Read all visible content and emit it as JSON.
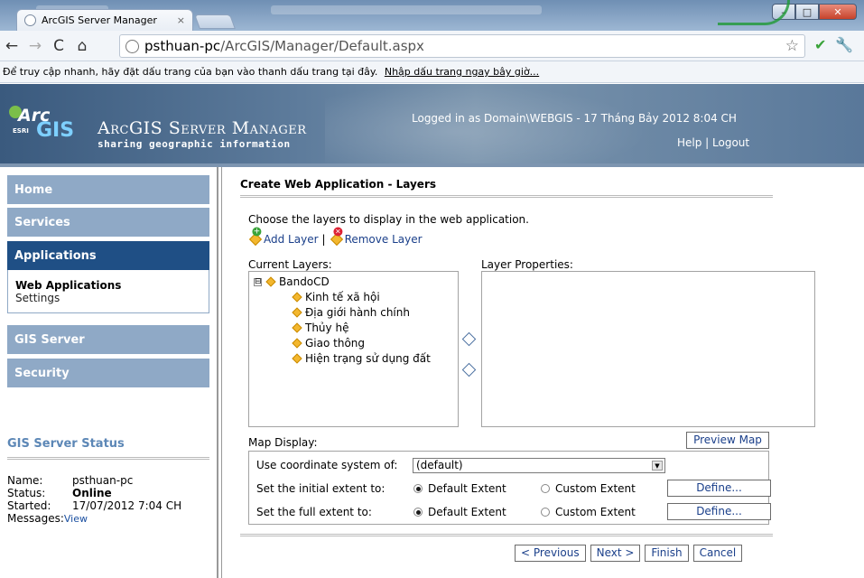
{
  "browser": {
    "tab_title": "ArcGIS Server Manager",
    "tab_close": "×",
    "url_host": "psthuan-pc",
    "url_path": "/ArcGIS/Manager/Default.aspx",
    "bookmark_hint": "Để truy cập nhanh, hãy đặt dấu trang của bạn vào thanh dấu trang tại đây.",
    "bookmark_link": "Nhập dấu trang ngay bây giờ...",
    "window_buttons": [
      "–",
      "□",
      "✕"
    ]
  },
  "header": {
    "logo_arc": "Arc",
    "logo_gis": "GIS",
    "logo_esri": "ESRI",
    "product_name": "ArcGIS Server Manager",
    "tagline": "sharing geographic information",
    "logged_in": "Logged in as Domain\\WEBGIS - 17 Tháng Bảy 2012 8:04 CH",
    "help_logout": "Help | Logout"
  },
  "sidebar": {
    "items": [
      {
        "label": "Home"
      },
      {
        "label": "Services"
      },
      {
        "label": "Applications"
      },
      {
        "label": "GIS Server"
      },
      {
        "label": "Security"
      }
    ],
    "subitems": {
      "current": "Web Applications",
      "other": "Settings"
    },
    "status": {
      "title": "GIS Server Status",
      "name_key": "Name:",
      "name_val": "psthuan-pc",
      "status_key": "Status:",
      "status_val": "Online",
      "started_key": "Started:",
      "started_val": "17/07/2012 7:04 CH",
      "messages_key": "Messages:",
      "messages_link": "View"
    }
  },
  "main": {
    "title": "Create Web Application - Layers",
    "instruction": "Choose the layers to display in the web application.",
    "add_layer": "Add Layer",
    "separator": "|",
    "remove_layer": "Remove Layer",
    "current_layers_label": "Current Layers:",
    "layer_properties_label": "Layer Properties:",
    "tree": {
      "expander": "⊟",
      "root": "BandoCD",
      "children": [
        "Kinh tế xã hội",
        "Địa giới hành chính",
        "Thủy hệ",
        "Giao thông",
        "Hiện trạng sử dụng đất"
      ]
    },
    "preview_map": "Preview Map",
    "map_display_label": "Map Display:",
    "coord_label": "Use coordinate system of:",
    "coord_value": "(default)",
    "initial_label": "Set the initial extent to:",
    "full_label": "Set the full extent to:",
    "default_extent": "Default Extent",
    "custom_extent": "Custom Extent",
    "define": "Define...",
    "buttons": {
      "previous": "< Previous",
      "next": "Next >",
      "finish": "Finish",
      "cancel": "Cancel"
    }
  }
}
